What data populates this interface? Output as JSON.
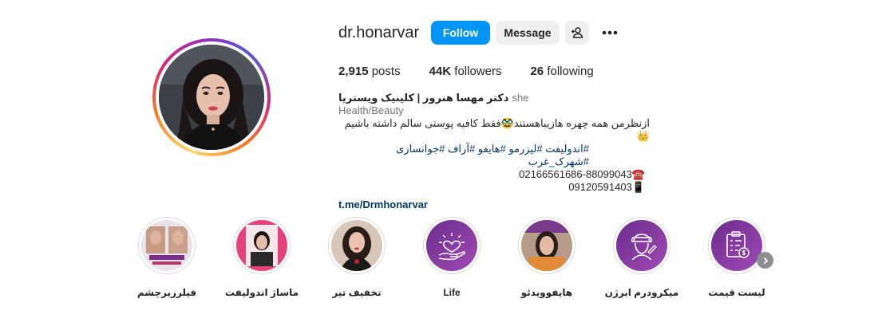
{
  "profile": {
    "username": "dr.honarvar",
    "buttons": {
      "follow": "Follow",
      "message": "Message"
    },
    "stats": {
      "posts_count": "2,915",
      "posts_label": "posts",
      "followers_count": "44K",
      "followers_label": "followers",
      "following_count": "26",
      "following_label": "following"
    },
    "bio": {
      "name": "دکتر مهسا هنرور | کلینیک ویستریا",
      "pronoun": "she",
      "category": "Health/Beauty",
      "line1": "ازنظرمن همه چهره هازیباهستند🥸فقط کافیه پوستی سالم داشته باشیم👑",
      "hashtags": "#اندولیفت #لیزرمو #هایفو #آراف #جوانسازی #شهرک_غرب",
      "phone1": "02166561686-88099043☎️",
      "phone2": "09120591403📱",
      "link": "t.me/Drmhonarvar"
    }
  },
  "highlights": [
    {
      "label": "فیلرزیرچشم",
      "icon": "filler-photo"
    },
    {
      "label": "ماساژ اندولیفت",
      "icon": "massage-photo"
    },
    {
      "label": "تخفیف تیر",
      "icon": "discount-photo"
    },
    {
      "label": "Life",
      "icon": "hand-heart-icon"
    },
    {
      "label": "هایفوویدئو",
      "icon": "hifu-photo"
    },
    {
      "label": "میکرودرم ابرژن",
      "icon": "face-care-icon"
    },
    {
      "label": "لیست قیمت",
      "icon": "price-list-icon"
    }
  ],
  "colors": {
    "accent": "#0095f6",
    "highlight_purple_1": "#5b2a86",
    "highlight_purple_2": "#9b3fb8",
    "link": "#00376b"
  }
}
